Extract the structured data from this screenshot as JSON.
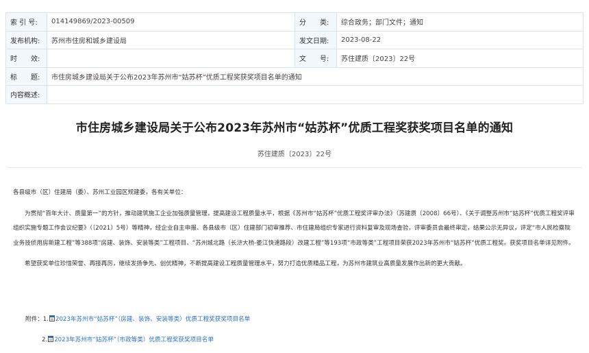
{
  "meta": {
    "rows": [
      [
        {
          "key": "索 引 号:",
          "value": "014149869/2023-00509"
        },
        {
          "key": "分　　类:",
          "value": "综合政务；部门文件；通知"
        }
      ],
      [
        {
          "key": "发布机构:",
          "value": "苏州市住房和城乡建设局"
        },
        {
          "key": "发文日期:",
          "value": "2023-08-22"
        }
      ],
      [
        {
          "key": "时　　效:",
          "value": ""
        },
        {
          "key": "文　　号:",
          "value": "苏住建质〔2023〕22号"
        }
      ]
    ],
    "title_key": "标　　题:",
    "title_value": "市住房城乡建设局关于公布2023年苏州市“姑苏杯”优质工程奖获奖项目名单的通知",
    "summary_key": "内容概述:",
    "summary_value": ""
  },
  "doc": {
    "title": "市住房城乡建设局关于公布2023年苏州市“姑苏杯”优质工程奖获奖项目名单的通知",
    "number": "苏住建质〔2023〕22号",
    "salutation": "各县级市（区）住建局（委）、苏州工业园区规建委，各有关单位：",
    "para1": "为贯彻“百年大计、质量第一”的方针，推动建筑施工企业加强质量管理，提高建设工程质量水平，根据《苏州市“姑苏杯”优质工程奖评审办法》（苏建质〔2008〕66号）、《关于调整苏州市“姑苏杯”优质工程奖评审组织实施专题工作会议纪要》（〔2021〕5号）等精神，经企业自主申报、各县级市（区）住建部门初审推荐、市住建局组织专家进行资料复审及现场查验，评审委员会最终审定，结果公示无异议，评定“市人民检察院业务技侦用房新建工程”等388项“房建、装饰、安装等类”工程项目、“苏州城北路（长浒大桥-娄江快速路段）改建工程”等193项“市政等类”工程项目荣获2023年苏州市“姑苏杯”优质工程奖。获奖项目名单详见附件。",
    "para2": "希望获奖单位珍惜荣誉、再接再厉，继续发扬争先、创优精神，不断提高建设工程质量管理水平，努力打造优质精品工程，为苏州市建筑业高质量发展作出新的更大贡献。",
    "attachments_label": "附件：",
    "att1_num": "1.",
    "att1_text": "2023年苏州市“姑苏杯”（房建、装饰、安装等类）优质工程奖获奖项目名单",
    "att2_num": "2.",
    "att2_text": "2023年苏州市“姑苏杯”（市政等类）优质工程奖获奖项目名单"
  },
  "colors": {
    "link": "#2b6fd1",
    "key_bg": "#f3f8fd",
    "border": "#d9e4f1"
  },
  "icons": {
    "attachment": "document-icon"
  }
}
